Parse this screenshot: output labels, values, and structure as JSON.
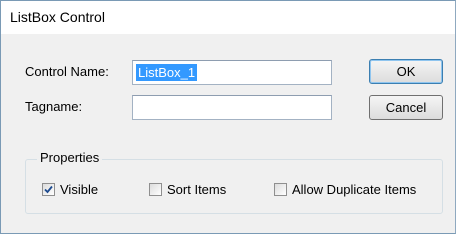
{
  "window": {
    "title": "ListBox Control"
  },
  "form": {
    "control_name_label": "Control Name:",
    "control_name_value": "ListBox_1",
    "tagname_label": "Tagname:",
    "tagname_value": ""
  },
  "buttons": {
    "ok": "OK",
    "cancel": "Cancel"
  },
  "properties": {
    "legend": "Properties",
    "visible": {
      "label": "Visible",
      "checked": true
    },
    "sort_items": {
      "label": "Sort Items",
      "checked": false
    },
    "allow_duplicates": {
      "label": "Allow Duplicate Items",
      "checked": false
    }
  },
  "colors": {
    "selection": "#3399ff",
    "check": "#1c4a8f"
  }
}
